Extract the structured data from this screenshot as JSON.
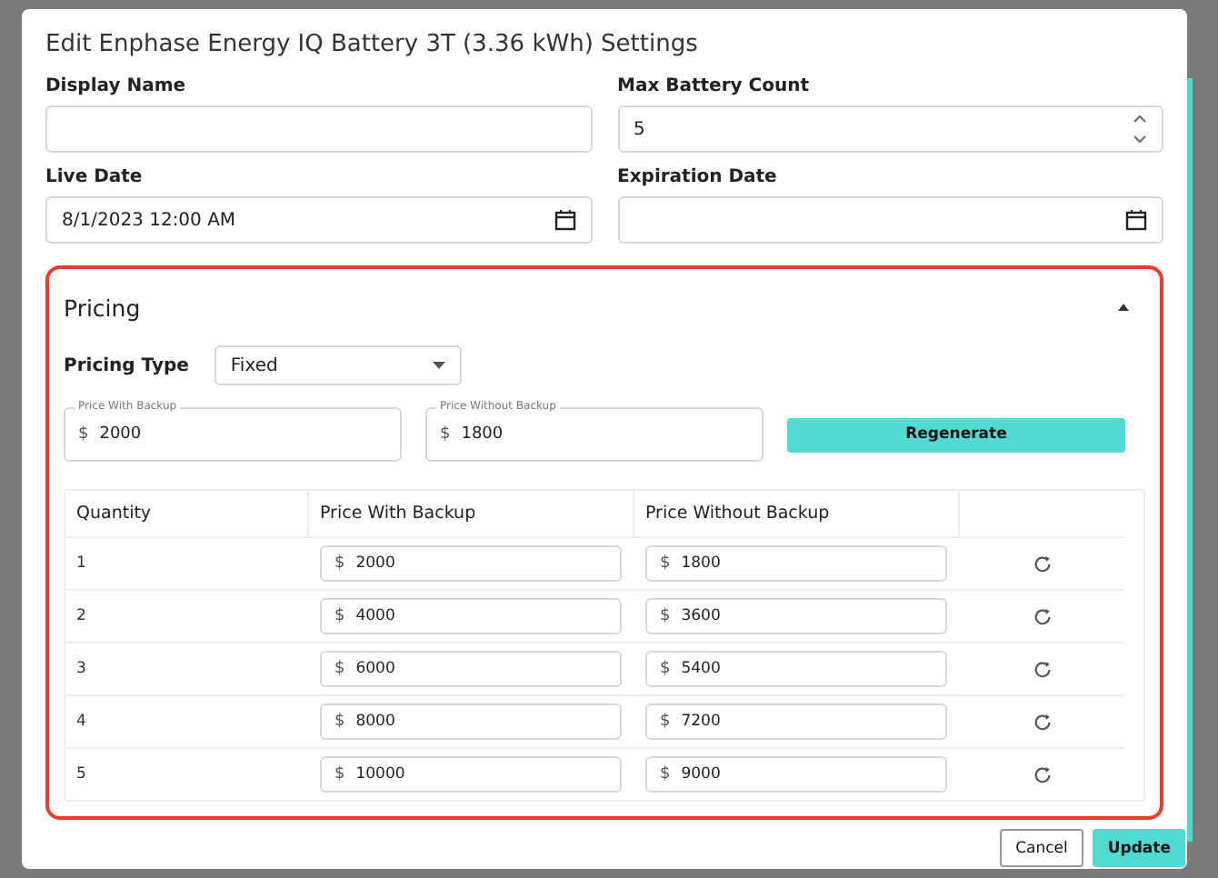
{
  "dialog": {
    "title": "Edit Enphase Energy IQ Battery 3T (3.36 kWh) Settings",
    "fields": [
      {
        "label": "Display Name",
        "kind": "text"
      },
      {
        "label": "Max Battery Count",
        "value": "5",
        "kind": "number"
      },
      {
        "label": "Live Date",
        "value": "8/1/2023 12:00 AM",
        "kind": "date"
      },
      {
        "label": "Expiration Date",
        "kind": "date"
      }
    ],
    "pricing": {
      "title": "Pricing",
      "expanded": true,
      "pricing_type": {
        "label": "Pricing Type",
        "value": "Fixed"
      },
      "base_prices": [
        {
          "label": "Price With Backup",
          "currency": "$",
          "value": "2000"
        },
        {
          "label": "Price Without Backup",
          "currency": "$",
          "value": "1800"
        }
      ],
      "regenerate_button": "Regenerate",
      "table": {
        "columns": [
          "Quantity",
          "Price With Backup",
          "Price Without Backup"
        ],
        "rows": [
          {
            "quantity": "1",
            "with_backup": "2000",
            "without_backup": "1800",
            "currency": "$"
          },
          {
            "quantity": "2",
            "with_backup": "4000",
            "without_backup": "3600",
            "currency": "$"
          },
          {
            "quantity": "3",
            "with_backup": "6000",
            "without_backup": "5400",
            "currency": "$"
          },
          {
            "quantity": "4",
            "with_backup": "8000",
            "without_backup": "7200",
            "currency": "$"
          },
          {
            "quantity": "5",
            "with_backup": "10000",
            "without_backup": "9000",
            "currency": "$"
          }
        ]
      }
    },
    "buttons": [
      {
        "label": "Cancel",
        "kind": "secondary"
      },
      {
        "label": "Update",
        "kind": "primary"
      }
    ]
  }
}
